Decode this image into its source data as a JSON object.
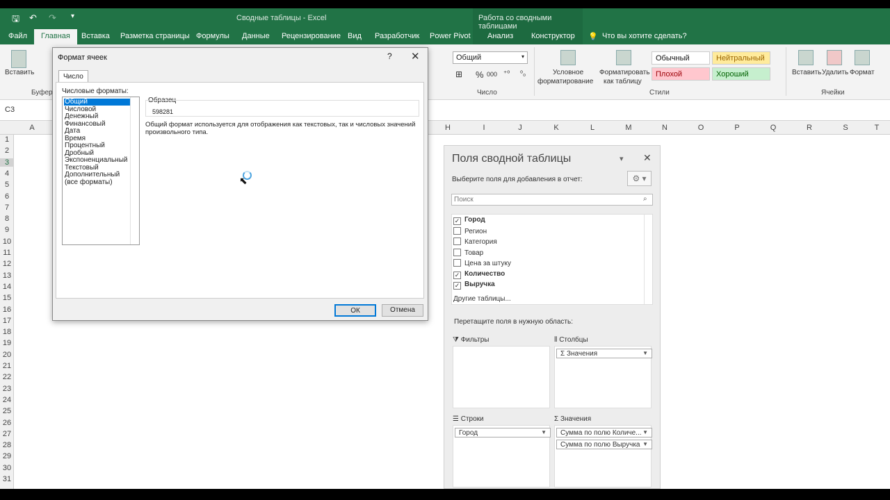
{
  "window": {
    "title": "Сводные таблицы  -  Excel",
    "context_group": "Работа со сводными таблицами"
  },
  "tabs": [
    "Файл",
    "Главная",
    "Вставка",
    "Разметка страницы",
    "Формулы",
    "Данные",
    "Рецензирование",
    "Вид",
    "Разработчик",
    "Power Pivot",
    "Анализ",
    "Конструктор"
  ],
  "active_tab": "Главная",
  "tell_me": "Что вы хотите сделать?",
  "ribbon": {
    "paste": "Вставить",
    "clipboard_group": "Буфер",
    "number_format": "Общий",
    "number_group": "Число",
    "cond_format_1": "Условное",
    "cond_format_2": "форматирование",
    "format_table_1": "Форматировать",
    "format_table_2": "как таблицу",
    "styles_group": "Стили",
    "styles": {
      "normal": "Обычный",
      "neutral": "Нейтральный",
      "bad": "Плохой",
      "good": "Хороший"
    },
    "insert": "Вставить",
    "delete": "Удалить",
    "format": "Формат",
    "cells_group": "Ячейки"
  },
  "name_box": "C3",
  "columns_left": [
    "A"
  ],
  "columns_right": [
    "H",
    "I",
    "J",
    "K",
    "L",
    "M",
    "N",
    "O",
    "P",
    "Q",
    "R",
    "S",
    "T"
  ],
  "rows": [
    "1",
    "2",
    "3",
    "4",
    "5",
    "6",
    "7",
    "8",
    "9",
    "10",
    "11",
    "12",
    "13",
    "14",
    "15",
    "16",
    "17",
    "18",
    "19",
    "20",
    "21",
    "22",
    "23",
    "24",
    "25",
    "26",
    "27",
    "28",
    "29",
    "30",
    "31"
  ],
  "dialog": {
    "title": "Формат ячеек",
    "help": "?",
    "tab": "Число",
    "categories_label": "Числовые форматы:",
    "categories": [
      "Общий",
      "Числовой",
      "Денежный",
      "Финансовый",
      "Дата",
      "Время",
      "Процентный",
      "Дробный",
      "Экспоненциальный",
      "Текстовый",
      "Дополнительный",
      "(все форматы)"
    ],
    "selected_category": "Общий",
    "sample_label": "Образец",
    "sample_value": "598281",
    "description": "Общий формат используется для отображения как текстовых, так и числовых значений произвольного типа.",
    "ok": "ОК",
    "cancel": "Отмена"
  },
  "pivot": {
    "title": "Поля сводной таблицы",
    "subtitle": "Выберите поля для добавления в отчет:",
    "search_placeholder": "Поиск",
    "fields": [
      {
        "name": "Город",
        "checked": true
      },
      {
        "name": "Регион",
        "checked": false
      },
      {
        "name": "Категория",
        "checked": false
      },
      {
        "name": "Товар",
        "checked": false
      },
      {
        "name": "Цена за штуку",
        "checked": false
      },
      {
        "name": "Количество",
        "checked": true
      },
      {
        "name": "Выручка",
        "checked": true
      }
    ],
    "more_tables": "Другие таблицы...",
    "drag_hint": "Перетащите поля в нужную область:",
    "areas": {
      "filters": "Фильтры",
      "columns": "Столбцы",
      "rows": "Строки",
      "values": "Значения"
    },
    "columns_items": [
      "Σ  Значения"
    ],
    "rows_items": [
      "Город"
    ],
    "values_items": [
      "Сумма по полю Количе...",
      "Сумма по полю Выручка"
    ]
  }
}
